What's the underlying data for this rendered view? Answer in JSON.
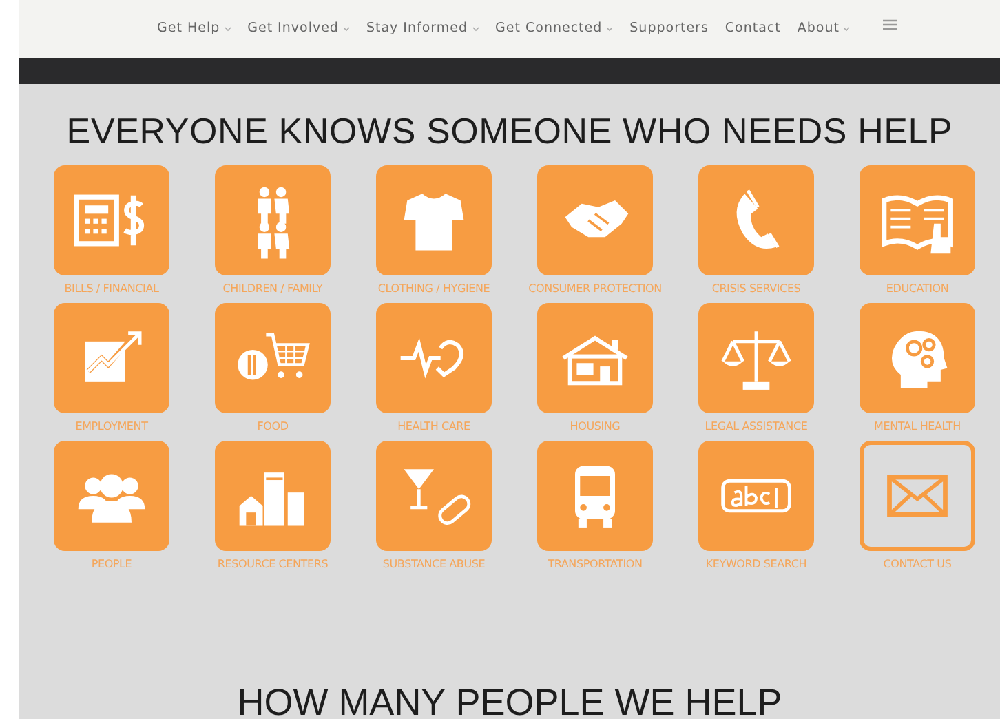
{
  "nav": {
    "items": [
      {
        "label": "Get Help",
        "has_menu": true
      },
      {
        "label": "Get Involved",
        "has_menu": true
      },
      {
        "label": "Stay Informed",
        "has_menu": true
      },
      {
        "label": "Get Connected",
        "has_menu": true
      },
      {
        "label": "Supporters",
        "has_menu": false
      },
      {
        "label": "Contact",
        "has_menu": false
      },
      {
        "label": "About",
        "has_menu": true
      }
    ]
  },
  "heading": "EVERYONE KNOWS SOMEONE WHO NEEDS HELP",
  "categories": [
    {
      "label": "BILLS / FINANCIAL",
      "kind": "filled"
    },
    {
      "label": "CHILDREN / FAMILY",
      "kind": "filled"
    },
    {
      "label": "CLOTHING / HYGIENE",
      "kind": "filled"
    },
    {
      "label": "CONSUMER PROTECTION",
      "kind": "filled"
    },
    {
      "label": "CRISIS SERVICES",
      "kind": "filled"
    },
    {
      "label": "EDUCATION",
      "kind": "filled"
    },
    {
      "label": "EMPLOYMENT",
      "kind": "filled"
    },
    {
      "label": "FOOD",
      "kind": "filled"
    },
    {
      "label": "HEALTH CARE",
      "kind": "filled"
    },
    {
      "label": "HOUSING",
      "kind": "filled"
    },
    {
      "label": "LEGAL ASSISTANCE",
      "kind": "filled"
    },
    {
      "label": "MENTAL HEALTH",
      "kind": "filled"
    },
    {
      "label": "PEOPLE",
      "kind": "filled"
    },
    {
      "label": "RESOURCE CENTERS",
      "kind": "filled"
    },
    {
      "label": "SUBSTANCE ABUSE",
      "kind": "filled"
    },
    {
      "label": "TRANSPORTATION",
      "kind": "filled"
    },
    {
      "label": "KEYWORD SEARCH",
      "kind": "filled"
    },
    {
      "label": "CONTACT US",
      "kind": "outline"
    }
  ],
  "subheading": "HOW MANY PEOPLE WE HELP"
}
